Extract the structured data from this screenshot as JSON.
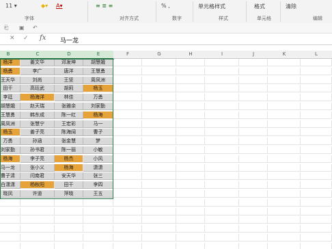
{
  "ribbon": {
    "groups": [
      "字体",
      "对齐方式",
      "数字",
      "样式",
      "单元格",
      "编辑"
    ],
    "tools": [
      "单元格样式",
      "格式",
      "清除"
    ]
  },
  "formula_bar": {
    "value": "马一龙"
  },
  "columns": [
    "B",
    "C",
    "D",
    "E",
    "F",
    "G",
    "H",
    "I",
    "J",
    "K",
    "L"
  ],
  "rows": [
    [
      "杨洋",
      "姜文华",
      "邓发坤",
      "胡慧娥"
    ],
    [
      "杨勇",
      "李广",
      "唐洋",
      "王慧勇"
    ],
    [
      "王天华",
      "刘尚",
      "王坚",
      "周凤洲"
    ],
    [
      "田干",
      "高珏武",
      "胡莉",
      "杨玉"
    ],
    [
      "李廷",
      "杨海洋",
      "林佳",
      "万勇"
    ],
    [
      "胡慧娥",
      "赵天瑞",
      "张雅余",
      "刘家勤"
    ],
    [
      "王慧勇",
      "韩东成",
      "陈一红",
      "杨海"
    ],
    [
      "周凤洲",
      "张慧宁",
      "王宏彩",
      "马一"
    ],
    [
      "杨玉",
      "姜子亮",
      "陈海阔",
      "曹子"
    ],
    [
      "万勇",
      "孙涵",
      "张金慧",
      "梦"
    ],
    [
      "刘家勤",
      "孙书君",
      "陈一丽",
      "小敏"
    ],
    [
      "杨海",
      "李子亮",
      "杨杰",
      "小风"
    ],
    [
      "马一龙",
      "张小义",
      "杨海",
      "潇潇"
    ],
    [
      "曹子清",
      "闫南君",
      "安天华",
      "张三"
    ],
    [
      "白潇潇",
      "杨秋阳",
      "田干",
      "李四"
    ],
    [
      "晓凤",
      "许道",
      "萍晓",
      "王五"
    ]
  ],
  "highlight": [
    [
      0,
      0
    ],
    [
      1,
      0
    ],
    [
      3,
      3
    ],
    [
      4,
      1
    ],
    [
      6,
      3
    ],
    [
      8,
      0
    ],
    [
      11,
      0
    ],
    [
      11,
      2
    ],
    [
      12,
      2
    ],
    [
      14,
      1
    ]
  ]
}
